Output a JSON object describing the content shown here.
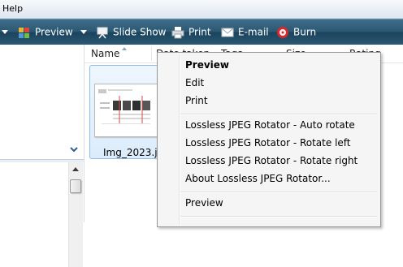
{
  "menubar": {
    "help_label": "Help"
  },
  "toolbar": {
    "preview_label": "Preview",
    "slideshow_label": "Slide Show",
    "print_label": "Print",
    "email_label": "E-mail",
    "burn_label": "Burn",
    "icons": [
      "nav-dropdown-arrow-icon",
      "preview-app-icon",
      "dropdown-arrow-icon",
      "slideshow-projector-icon",
      "printer-icon",
      "email-envelope-icon",
      "burn-disc-icon"
    ]
  },
  "columns": {
    "name": "Name",
    "date_taken": "Date taken",
    "tags": "Tags",
    "size": "Size",
    "rating": "Rating"
  },
  "file": {
    "name": "Img_2023.jpg"
  },
  "context_menu": {
    "items": [
      {
        "label": "Preview",
        "bold": true
      },
      {
        "label": "Edit"
      },
      {
        "label": "Print"
      },
      {
        "label": "Lossless JPEG Rotator - Auto rotate"
      },
      {
        "label": "Lossless JPEG Rotator - Rotate left"
      },
      {
        "label": "Lossless JPEG Rotator - Rotate right"
      },
      {
        "label": "About Lossless JPEG Rotator..."
      },
      {
        "label": "Preview"
      }
    ]
  },
  "colors": {
    "toolbar": "#2b5873",
    "selection": "#dcecfb",
    "menu_bg": "#f5f5f5"
  }
}
